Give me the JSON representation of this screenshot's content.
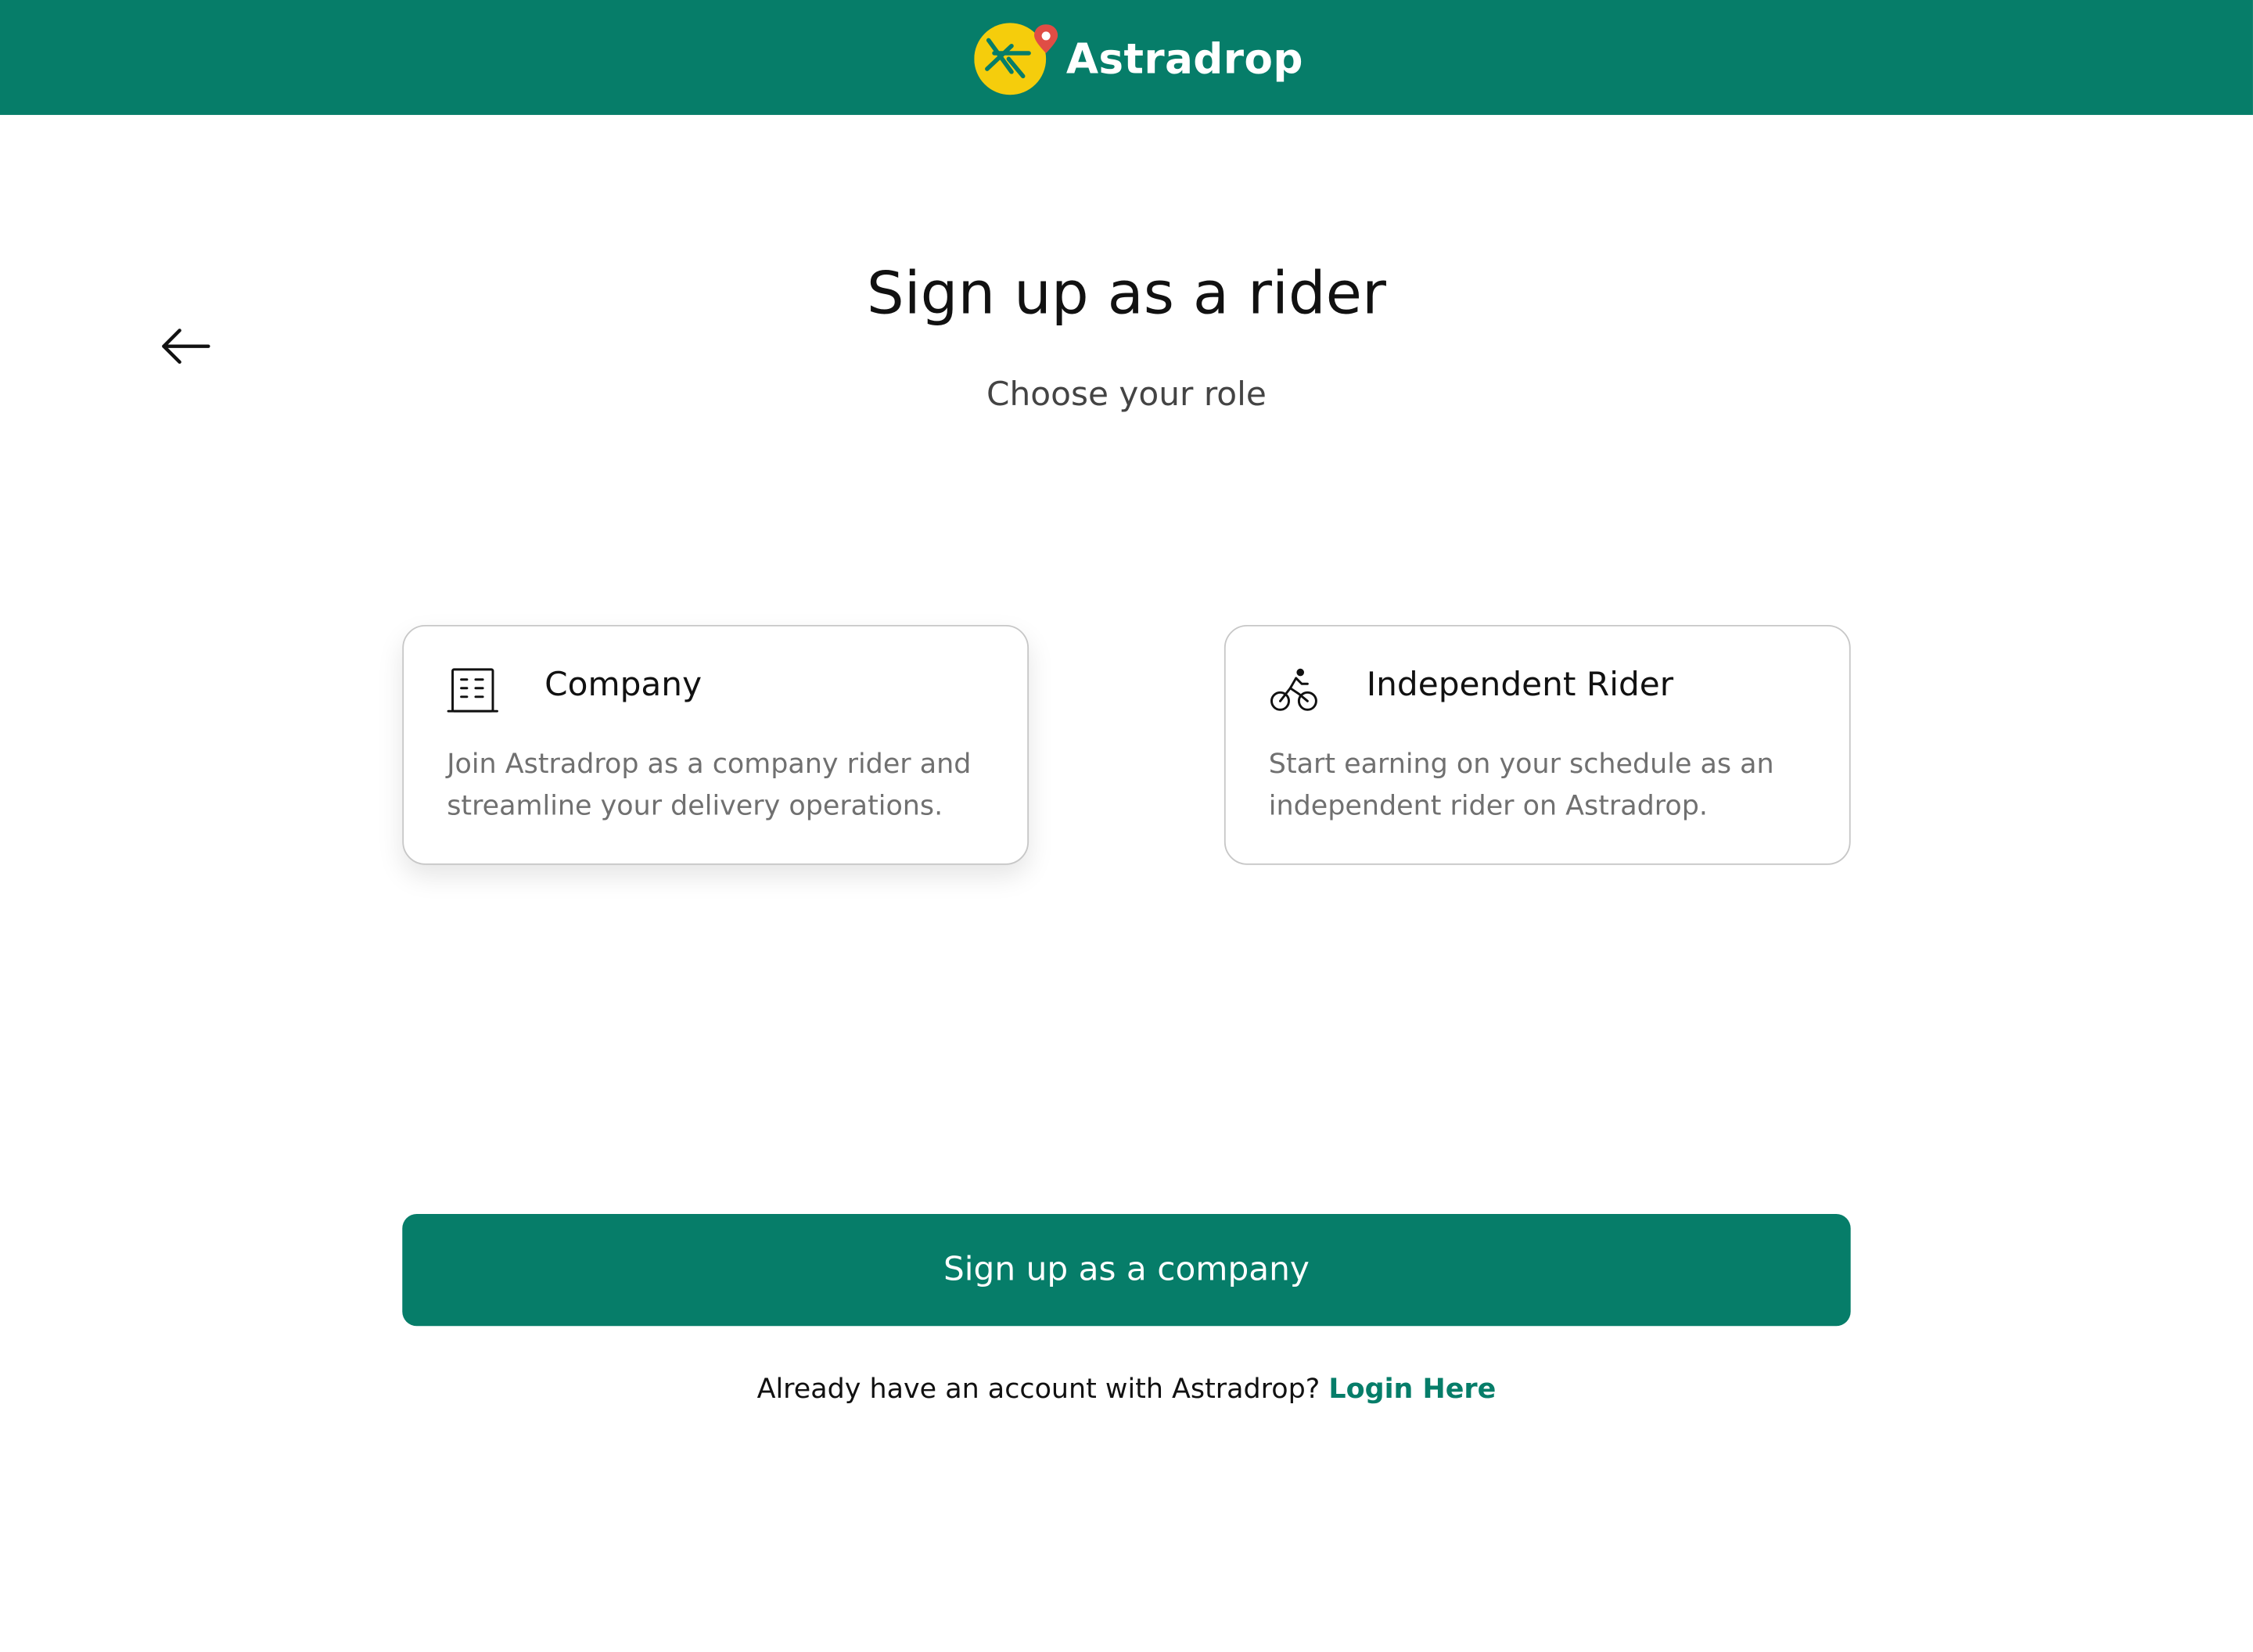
{
  "header": {
    "brand_name": "Astradrop",
    "logo_icon": "astradrop-logo-icon",
    "bar_color": "#067d69",
    "logo_circle_color": "#f5cd0c",
    "logo_pin_color": "#e04d45"
  },
  "navigation": {
    "back_icon": "arrow-left-icon"
  },
  "main": {
    "title": "Sign up as a rider",
    "subtitle": "Choose your role"
  },
  "roles": [
    {
      "icon": "building-icon",
      "title": "Company",
      "description": "Join Astradrop as a company rider and streamline your delivery operations.",
      "selected": true
    },
    {
      "icon": "cyclist-icon",
      "title": "Independent Rider",
      "description": "Start earning on your schedule as an independent rider on Astradrop.",
      "selected": false
    }
  ],
  "actions": {
    "primary_label": "Sign up as a company",
    "login_prompt": "Already have an account with Astradrop?",
    "login_link": "Login Here"
  }
}
